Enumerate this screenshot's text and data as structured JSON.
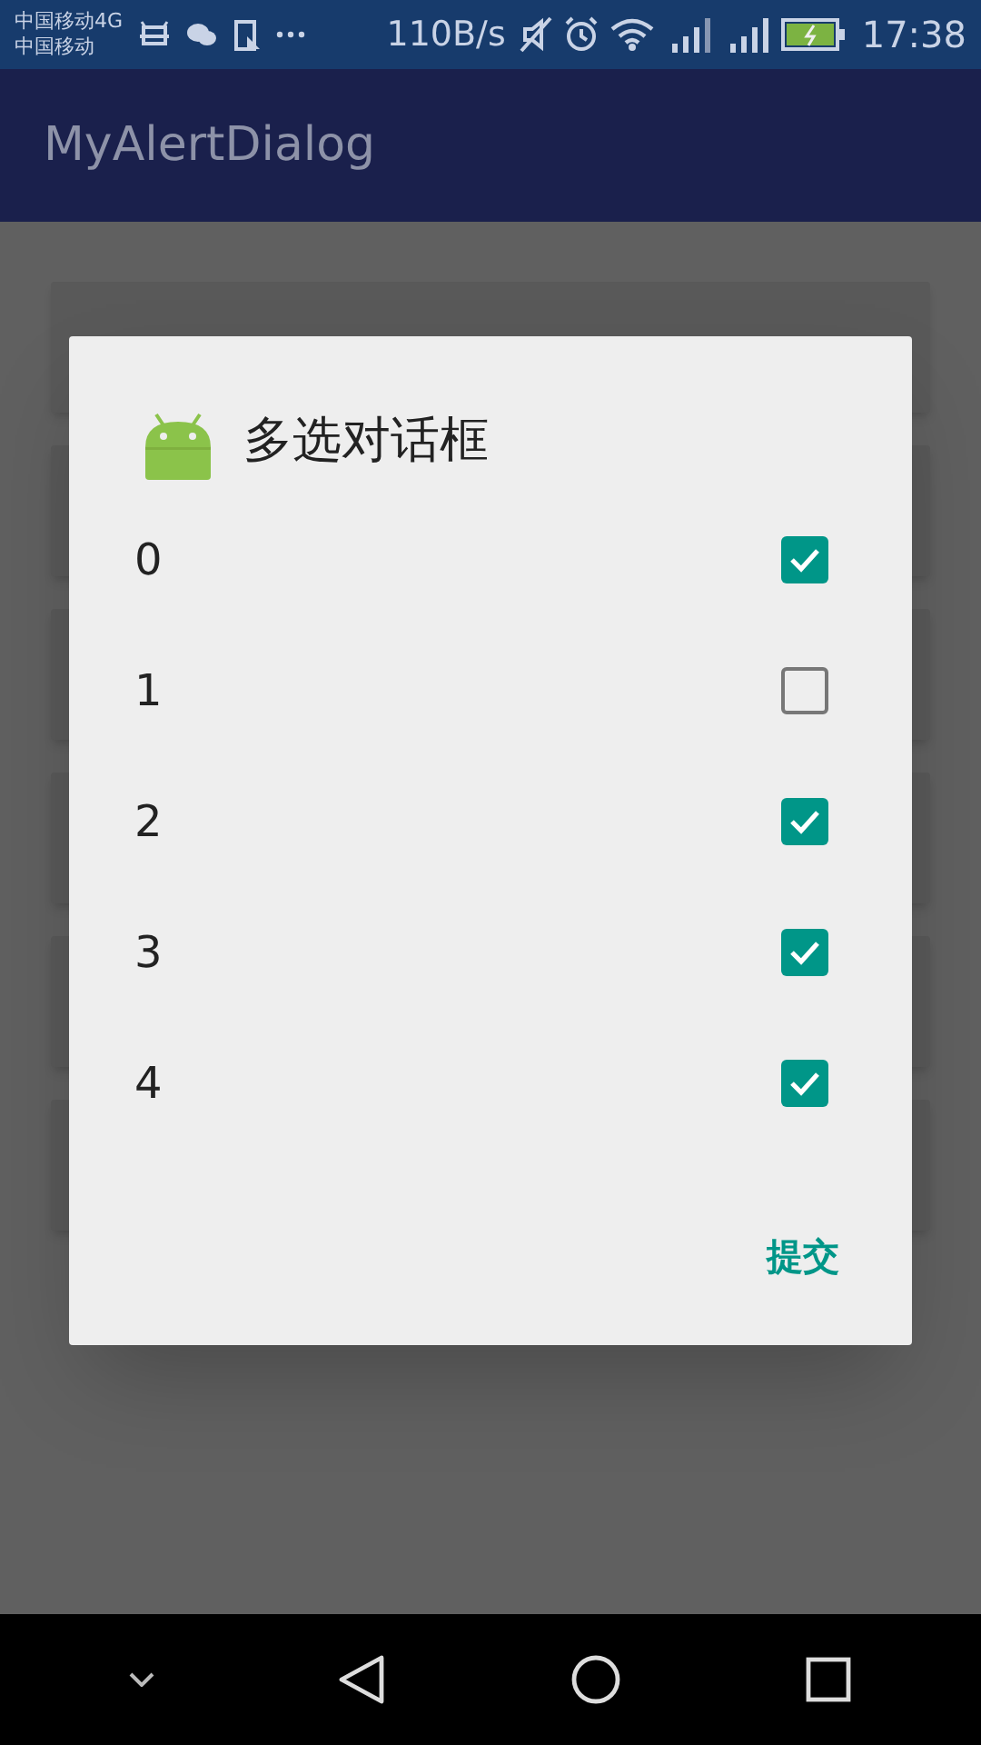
{
  "status_bar": {
    "carrier_1": "中国移动4G",
    "carrier_2": "中国移动",
    "speed": "110B/s",
    "time": "17:38"
  },
  "app_bar": {
    "title": "MyAlertDialog"
  },
  "dialog": {
    "title": "多选对话框",
    "items": [
      {
        "label": "0",
        "checked": true
      },
      {
        "label": "1",
        "checked": false
      },
      {
        "label": "2",
        "checked": true
      },
      {
        "label": "3",
        "checked": true
      },
      {
        "label": "4",
        "checked": true
      }
    ],
    "button": "提交"
  }
}
